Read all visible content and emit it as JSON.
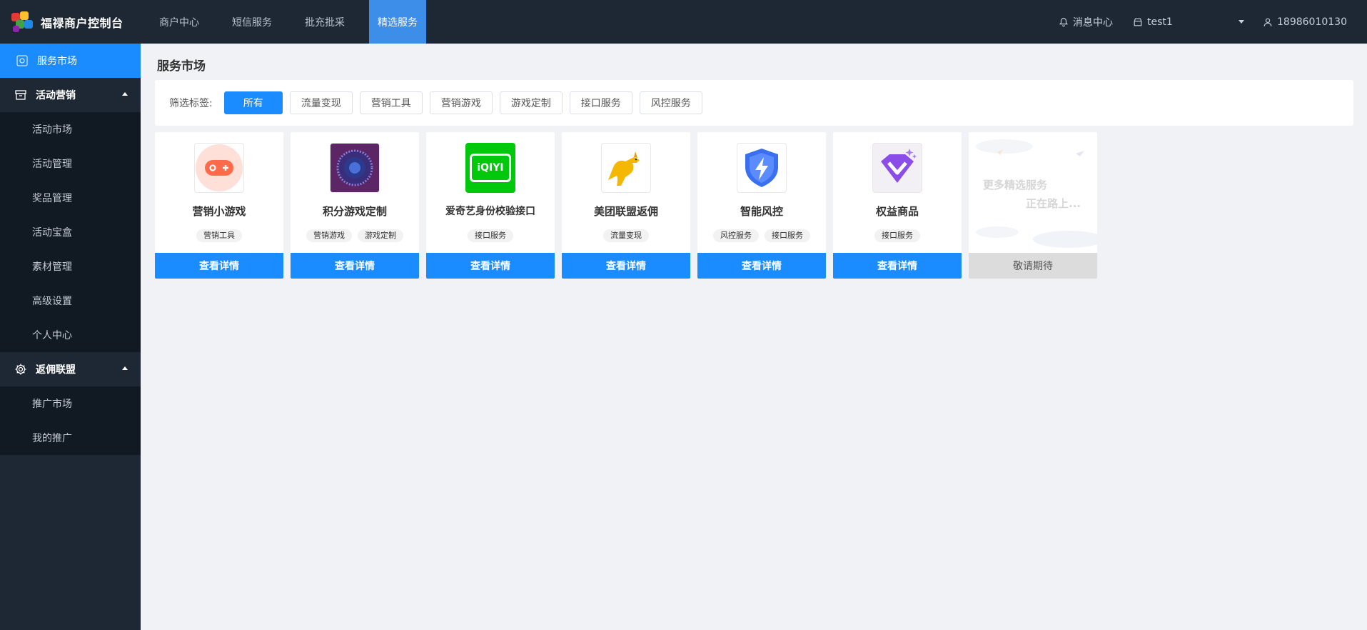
{
  "brand": {
    "title": "福禄商户控制台"
  },
  "topnav": [
    {
      "label": "商户中心"
    },
    {
      "label": "短信服务"
    },
    {
      "label": "批充批采"
    },
    {
      "label": "精选服务",
      "active": true
    }
  ],
  "header_right": {
    "message_center": "消息中心",
    "store_name": "test1",
    "user_phone": "18986010130"
  },
  "sidebar": {
    "service_market": "服务市场",
    "group_marketing": {
      "label": "活动营销",
      "items": [
        "活动市场",
        "活动管理",
        "奖品管理",
        "活动宝盒",
        "素材管理",
        "高级设置",
        "个人中心"
      ]
    },
    "group_rebate": {
      "label": "返佣联盟",
      "items": [
        "推广市场",
        "我的推广"
      ]
    }
  },
  "main": {
    "page_title": "服务市场",
    "filter_label": "筛选标签:",
    "filters": [
      "所有",
      "流量变现",
      "营销工具",
      "营销游戏",
      "游戏定制",
      "接口服务",
      "风控服务"
    ],
    "cards": [
      {
        "name": "营销小游戏",
        "tags": [
          "营销工具"
        ],
        "button": "查看详情",
        "icon": "gamepad-icon"
      },
      {
        "name": "积分游戏定制",
        "tags": [
          "营销游戏",
          "游戏定制"
        ],
        "button": "查看详情",
        "icon": "game-badge-icon"
      },
      {
        "name": "爱奇艺身份校验接口",
        "tags": [
          "接口服务"
        ],
        "button": "查看详情",
        "icon": "iqiyi-logo-icon",
        "logo_text": "iQIYI"
      },
      {
        "name": "美团联盟返佣",
        "tags": [
          "流量变现"
        ],
        "button": "查看详情",
        "icon": "kangaroo-icon"
      },
      {
        "name": "智能风控",
        "tags": [
          "风控服务",
          "接口服务"
        ],
        "button": "查看详情",
        "icon": "shield-bolt-icon"
      },
      {
        "name": "权益商品",
        "tags": [
          "接口服务"
        ],
        "button": "查看详情",
        "icon": "diamond-icon"
      }
    ],
    "placeholder_card": {
      "line1": "更多精选服务",
      "line2": "正在路上...",
      "button": "敬请期待"
    }
  },
  "colors": {
    "primary": "#1a8cff",
    "header_bg": "#1e2734",
    "sidebar_sub_bg": "#111923",
    "page_bg": "#f0f2f5"
  }
}
